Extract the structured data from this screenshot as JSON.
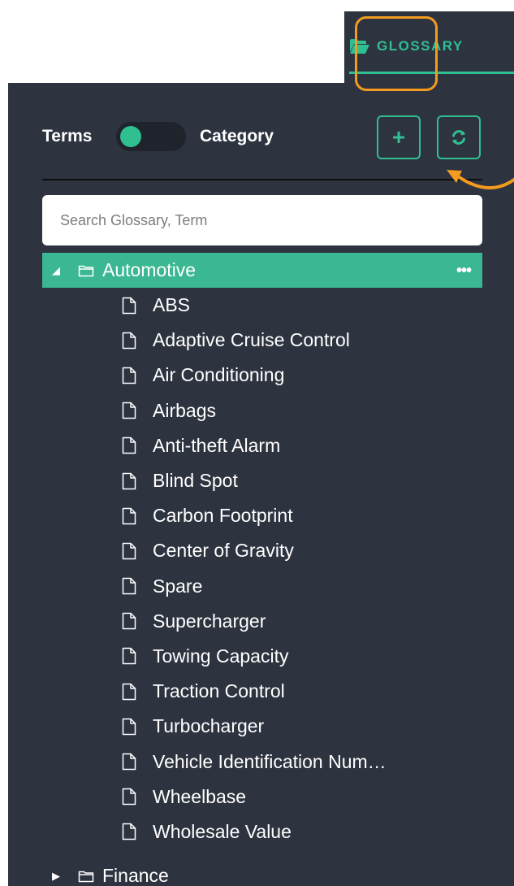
{
  "tab": {
    "label": "GLOSSARY",
    "icon": "folder-open-icon"
  },
  "toolbar": {
    "terms_label": "Terms",
    "category_label": "Category",
    "toggle_state": "terms",
    "add_button_label": "+",
    "refresh_icon": "refresh-icon"
  },
  "search": {
    "placeholder": "Search Glossary, Term",
    "value": ""
  },
  "tree": {
    "categories": [
      {
        "label": "Automotive",
        "expanded": true,
        "selected": true,
        "more": "•••",
        "terms": [
          "ABS",
          "Adaptive Cruise Control",
          "Air Conditioning",
          "Airbags",
          "Anti-theft Alarm",
          "Blind Spot",
          "Carbon Footprint",
          "Center of Gravity",
          "Spare",
          "Supercharger",
          "Towing Capacity",
          "Traction Control",
          "Turbocharger",
          "Vehicle Identification Num…",
          "Wheelbase",
          "Wholesale Value"
        ]
      },
      {
        "label": "Finance",
        "expanded": false,
        "selected": false,
        "terms": []
      }
    ]
  },
  "colors": {
    "panel_bg": "#2e3340",
    "accent": "#2fbf91",
    "selected_row": "#3bb893",
    "annotation": "#f39b1f"
  }
}
